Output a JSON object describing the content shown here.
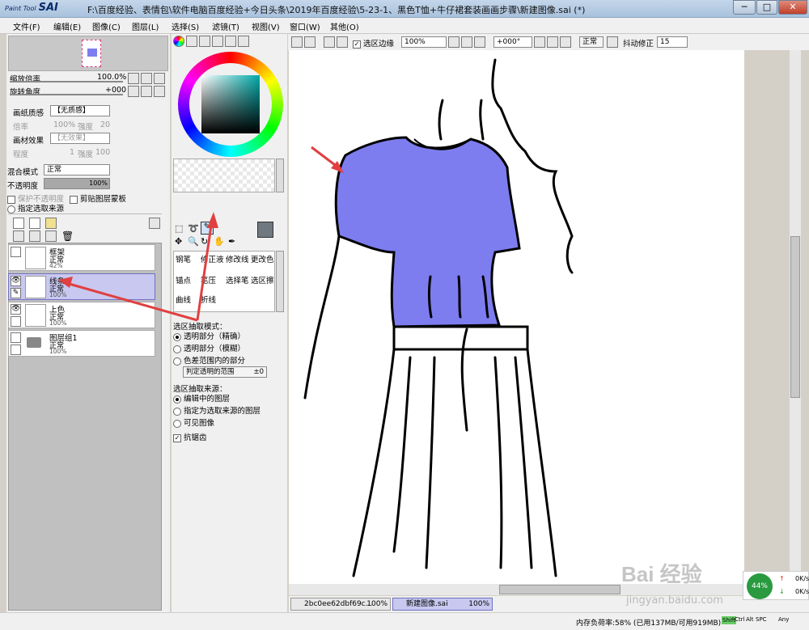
{
  "app": {
    "logo_small": "Paint Tool",
    "logo": "SAI",
    "title": "F:\\百度经验、表情包\\软件电脑百度经验+今日头条\\2019年百度经验\\5-23-1、黑色T恤+牛仔裙套装画画步骤\\新建图像.sai (*)"
  },
  "window": {
    "minimize": "─",
    "maximize": "□",
    "close": "✕"
  },
  "menus": [
    "文件(F)",
    "编辑(E)",
    "图像(C)",
    "图层(L)",
    "选择(S)",
    "滤镜(T)",
    "视图(V)",
    "窗口(W)",
    "其他(O)"
  ],
  "navigator": {
    "zoom_label": "缩放倍率",
    "zoom_value": "100.0%",
    "rotate_label": "旋转角度",
    "rotate_value": "+000"
  },
  "paper": {
    "texture_label": "画纸质感",
    "texture_value": "【无质感】",
    "scale_label": "倍率",
    "scale_value": "100%",
    "strength_label": "强度",
    "strength_value": "20",
    "effect_label": "画材效果",
    "effect_value": "【无效果】",
    "width_label": "程度",
    "width_value": "1",
    "effect_strength_label": "强度",
    "effect_strength_value": "100"
  },
  "blend": {
    "mode_label": "混合模式",
    "mode_value": "正常",
    "opacity_label": "不透明度",
    "opacity_value": "100%",
    "protect_label": "保护不透明度",
    "clip_label": "剪贴图层蒙板",
    "source_label": "指定选取来源"
  },
  "layers": [
    {
      "name": "框架",
      "mode": "正常",
      "opacity": "42%",
      "selected": false
    },
    {
      "name": "线条",
      "mode": "正常",
      "opacity": "100%",
      "selected": true
    },
    {
      "name": "上色",
      "mode": "正常",
      "opacity": "100%",
      "selected": false
    },
    {
      "name": "图层组1",
      "mode": "正常",
      "opacity": "100%",
      "selected": false
    }
  ],
  "tools": {
    "row1": [
      "钢笔",
      "修正液",
      "修改线",
      "更改色"
    ],
    "row2": [
      "锚点",
      "笔压",
      "选择笔",
      "选区擦"
    ],
    "row3": [
      "曲线",
      "折线"
    ]
  },
  "options": {
    "extract_mode_label": "选区抽取模式：",
    "mode1": "透明部分（精确）",
    "mode2": "透明部分（模糊）",
    "mode3": "色差范围内的部分",
    "range_label": "判定透明的范围",
    "range_value": "±0",
    "source_label": "选区抽取来源：",
    "src1": "编辑中的图层",
    "src2": "指定为选取来源的图层",
    "src3": "可见图像",
    "antialias": "抗锯齿"
  },
  "canvas_toolbar": {
    "selection_edge": "选区边缘",
    "zoom": "100%",
    "angle": "+000°",
    "mode": "正常",
    "stabilizer_label": "抖动修正",
    "stabilizer_value": "15"
  },
  "tabs": [
    {
      "name": "2bc0ee62dbf69c...",
      "zoom": "100%"
    },
    {
      "name": "新建图像.sai",
      "zoom": "100%"
    }
  ],
  "status": {
    "memory": "内存负荷率:58% (已用137MB/可用919MB)",
    "keys": [
      "Shift",
      "Ctrl",
      "Alt",
      "SPC",
      "Any"
    ],
    "net_percent": "44%",
    "up": "0K/s",
    "down": "0K/s",
    "watermark": "Bai 经验",
    "watermark_url": "jingyan.baidu.com"
  },
  "colors": {
    "shirt": "#7d7df0",
    "accent_red": "#e04040",
    "selected_layer": "#c8c8f0"
  }
}
